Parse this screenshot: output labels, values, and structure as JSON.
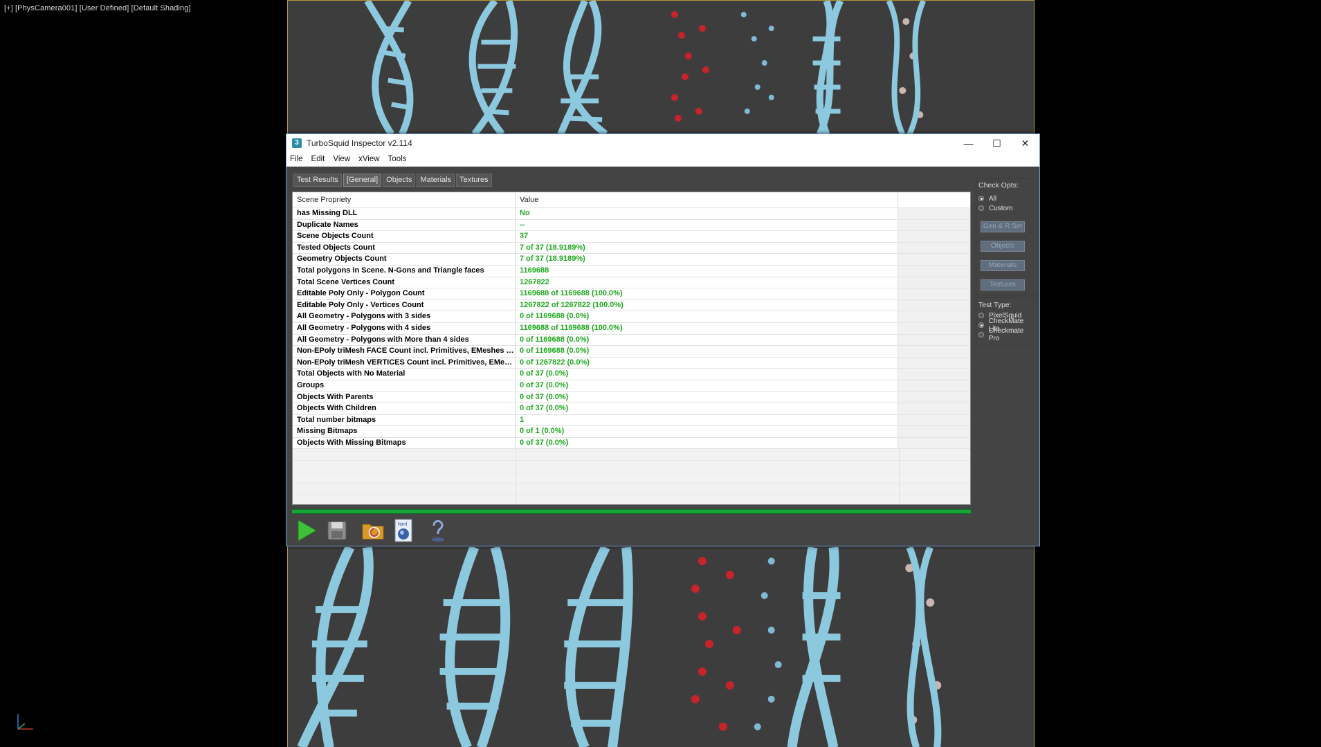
{
  "viewport": {
    "label": "[+] [PhysCamera001] [User Defined] [Default Shading]"
  },
  "window": {
    "title": "TurboSquid Inspector v2.114",
    "icon_label": "3",
    "controls": {
      "minimize": "—",
      "maximize": "☐",
      "close": "✕"
    }
  },
  "menu": [
    "File",
    "Edit",
    "View",
    "xView",
    "Tools"
  ],
  "tabs": [
    "Test Results",
    "[General]",
    "Objects",
    "Materials",
    "Textures"
  ],
  "table": {
    "headers": [
      "Scene Propriety",
      "Value",
      ""
    ],
    "rows": [
      {
        "name": "has Missing DLL",
        "value": "No"
      },
      {
        "name": "Duplicate Names",
        "value": "--"
      },
      {
        "name": "Scene Objects Count",
        "value": "37"
      },
      {
        "name": "Tested Objects Count",
        "value": "7 of 37 (18.9189%)"
      },
      {
        "name": "Geometry Objects Count",
        "value": "7 of 37 (18.9189%)"
      },
      {
        "name": "Total polygons in Scene. N-Gons and Triangle faces",
        "value": "1169688"
      },
      {
        "name": "Total Scene Vertices Count",
        "value": "1267822"
      },
      {
        "name": "Editable Poly Only - Polygon Count",
        "value": "1169688 of 1169688 (100.0%)"
      },
      {
        "name": "Editable Poly Only - Vertices Count",
        "value": "1267822 of 1267822 (100.0%)"
      },
      {
        "name": "All Geometry - Polygons with 3 sides",
        "value": "0 of 1169688 (0.0%)"
      },
      {
        "name": "All Geometry - Polygons with 4 sides",
        "value": "1169688 of 1169688 (100.0%)"
      },
      {
        "name": "All Geometry - Polygons with More than 4 sides",
        "value": "0 of 1169688 (0.0%)"
      },
      {
        "name": "Non-EPoly triMesh FACE Count incl. Primitives, EMeshes etc...",
        "value": "0 of 1169688 (0.0%)"
      },
      {
        "name": "Non-EPoly triMesh VERTICES Count incl. Primitives, EMeshes ...",
        "value": "0 of 1267822 (0.0%)"
      },
      {
        "name": "Total Objects with No Material",
        "value": "0 of 37 (0.0%)"
      },
      {
        "name": "Groups",
        "value": "0 of 37 (0.0%)"
      },
      {
        "name": "Objects With Parents",
        "value": "0 of 37 (0.0%)"
      },
      {
        "name": "Objects With Children",
        "value": "0 of 37 (0.0%)"
      },
      {
        "name": "Total number bitmaps",
        "value": "1"
      },
      {
        "name": "Missing Bitmaps",
        "value": "0 of 1 (0.0%)"
      },
      {
        "name": "Objects With Missing Bitmaps",
        "value": "0 of 37 (0.0%)"
      }
    ]
  },
  "progress": {
    "value": 1.0
  },
  "toolbar": {
    "tools": [
      "play-icon",
      "save-icon",
      "folder-icon",
      "html-icon",
      "help-icon"
    ],
    "html_text": "html"
  },
  "side": {
    "check_title": "Check Opts:",
    "check_options": [
      "All",
      "Custom"
    ],
    "check_selected": "All",
    "buttons": [
      "Gen & R.Set",
      "Objects",
      "Materials",
      "Textures"
    ],
    "test_title": "Test Type:",
    "test_options": [
      "PixelSquid",
      "CheckMate Lite",
      "Checkmate Pro"
    ],
    "test_selected": "CheckMate Lite"
  }
}
